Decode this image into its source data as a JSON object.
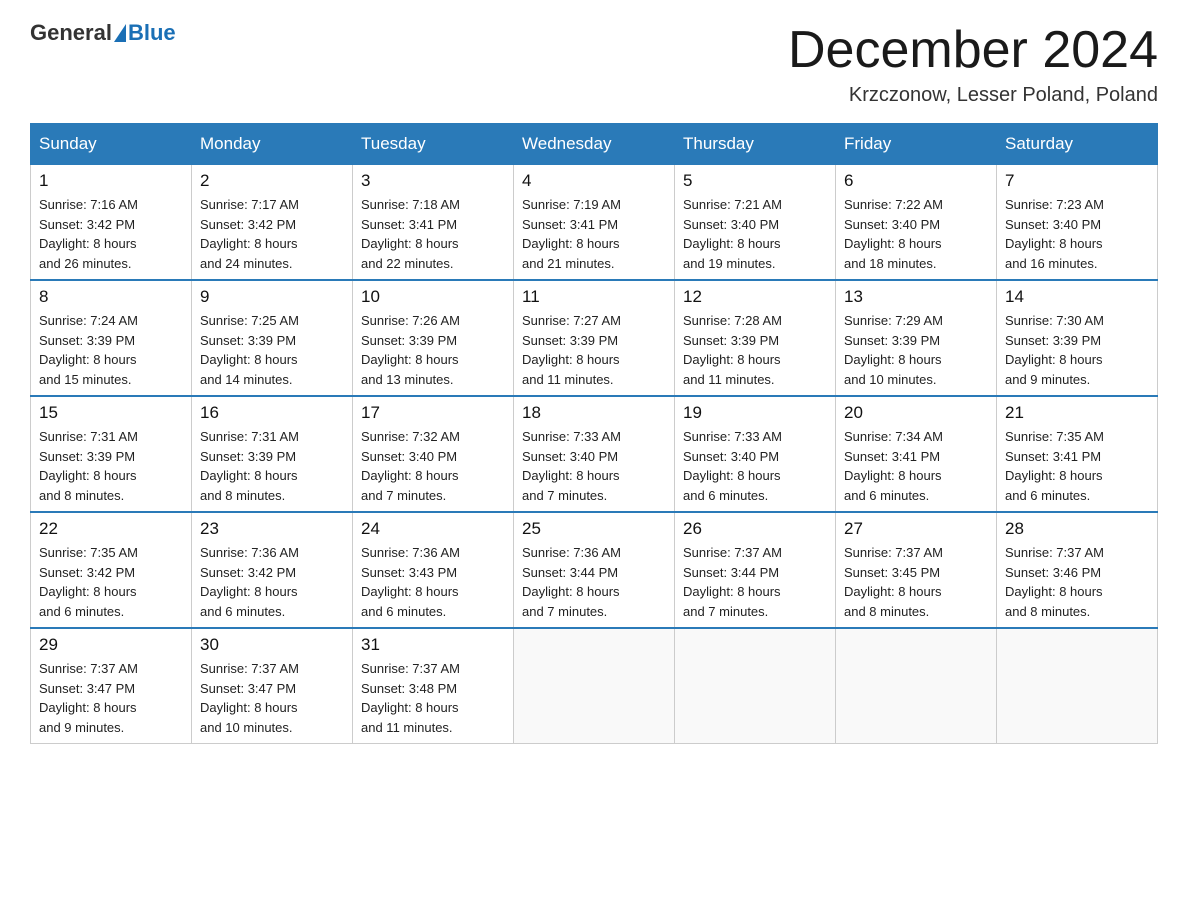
{
  "header": {
    "logo_general": "General",
    "logo_blue": "Blue",
    "month_title": "December 2024",
    "location": "Krzczonow, Lesser Poland, Poland"
  },
  "days_of_week": [
    "Sunday",
    "Monday",
    "Tuesday",
    "Wednesday",
    "Thursday",
    "Friday",
    "Saturday"
  ],
  "weeks": [
    [
      {
        "day": "1",
        "info": "Sunrise: 7:16 AM\nSunset: 3:42 PM\nDaylight: 8 hours\nand 26 minutes."
      },
      {
        "day": "2",
        "info": "Sunrise: 7:17 AM\nSunset: 3:42 PM\nDaylight: 8 hours\nand 24 minutes."
      },
      {
        "day": "3",
        "info": "Sunrise: 7:18 AM\nSunset: 3:41 PM\nDaylight: 8 hours\nand 22 minutes."
      },
      {
        "day": "4",
        "info": "Sunrise: 7:19 AM\nSunset: 3:41 PM\nDaylight: 8 hours\nand 21 minutes."
      },
      {
        "day": "5",
        "info": "Sunrise: 7:21 AM\nSunset: 3:40 PM\nDaylight: 8 hours\nand 19 minutes."
      },
      {
        "day": "6",
        "info": "Sunrise: 7:22 AM\nSunset: 3:40 PM\nDaylight: 8 hours\nand 18 minutes."
      },
      {
        "day": "7",
        "info": "Sunrise: 7:23 AM\nSunset: 3:40 PM\nDaylight: 8 hours\nand 16 minutes."
      }
    ],
    [
      {
        "day": "8",
        "info": "Sunrise: 7:24 AM\nSunset: 3:39 PM\nDaylight: 8 hours\nand 15 minutes."
      },
      {
        "day": "9",
        "info": "Sunrise: 7:25 AM\nSunset: 3:39 PM\nDaylight: 8 hours\nand 14 minutes."
      },
      {
        "day": "10",
        "info": "Sunrise: 7:26 AM\nSunset: 3:39 PM\nDaylight: 8 hours\nand 13 minutes."
      },
      {
        "day": "11",
        "info": "Sunrise: 7:27 AM\nSunset: 3:39 PM\nDaylight: 8 hours\nand 11 minutes."
      },
      {
        "day": "12",
        "info": "Sunrise: 7:28 AM\nSunset: 3:39 PM\nDaylight: 8 hours\nand 11 minutes."
      },
      {
        "day": "13",
        "info": "Sunrise: 7:29 AM\nSunset: 3:39 PM\nDaylight: 8 hours\nand 10 minutes."
      },
      {
        "day": "14",
        "info": "Sunrise: 7:30 AM\nSunset: 3:39 PM\nDaylight: 8 hours\nand 9 minutes."
      }
    ],
    [
      {
        "day": "15",
        "info": "Sunrise: 7:31 AM\nSunset: 3:39 PM\nDaylight: 8 hours\nand 8 minutes."
      },
      {
        "day": "16",
        "info": "Sunrise: 7:31 AM\nSunset: 3:39 PM\nDaylight: 8 hours\nand 8 minutes."
      },
      {
        "day": "17",
        "info": "Sunrise: 7:32 AM\nSunset: 3:40 PM\nDaylight: 8 hours\nand 7 minutes."
      },
      {
        "day": "18",
        "info": "Sunrise: 7:33 AM\nSunset: 3:40 PM\nDaylight: 8 hours\nand 7 minutes."
      },
      {
        "day": "19",
        "info": "Sunrise: 7:33 AM\nSunset: 3:40 PM\nDaylight: 8 hours\nand 6 minutes."
      },
      {
        "day": "20",
        "info": "Sunrise: 7:34 AM\nSunset: 3:41 PM\nDaylight: 8 hours\nand 6 minutes."
      },
      {
        "day": "21",
        "info": "Sunrise: 7:35 AM\nSunset: 3:41 PM\nDaylight: 8 hours\nand 6 minutes."
      }
    ],
    [
      {
        "day": "22",
        "info": "Sunrise: 7:35 AM\nSunset: 3:42 PM\nDaylight: 8 hours\nand 6 minutes."
      },
      {
        "day": "23",
        "info": "Sunrise: 7:36 AM\nSunset: 3:42 PM\nDaylight: 8 hours\nand 6 minutes."
      },
      {
        "day": "24",
        "info": "Sunrise: 7:36 AM\nSunset: 3:43 PM\nDaylight: 8 hours\nand 6 minutes."
      },
      {
        "day": "25",
        "info": "Sunrise: 7:36 AM\nSunset: 3:44 PM\nDaylight: 8 hours\nand 7 minutes."
      },
      {
        "day": "26",
        "info": "Sunrise: 7:37 AM\nSunset: 3:44 PM\nDaylight: 8 hours\nand 7 minutes."
      },
      {
        "day": "27",
        "info": "Sunrise: 7:37 AM\nSunset: 3:45 PM\nDaylight: 8 hours\nand 8 minutes."
      },
      {
        "day": "28",
        "info": "Sunrise: 7:37 AM\nSunset: 3:46 PM\nDaylight: 8 hours\nand 8 minutes."
      }
    ],
    [
      {
        "day": "29",
        "info": "Sunrise: 7:37 AM\nSunset: 3:47 PM\nDaylight: 8 hours\nand 9 minutes."
      },
      {
        "day": "30",
        "info": "Sunrise: 7:37 AM\nSunset: 3:47 PM\nDaylight: 8 hours\nand 10 minutes."
      },
      {
        "day": "31",
        "info": "Sunrise: 7:37 AM\nSunset: 3:48 PM\nDaylight: 8 hours\nand 11 minutes."
      },
      {
        "day": "",
        "info": ""
      },
      {
        "day": "",
        "info": ""
      },
      {
        "day": "",
        "info": ""
      },
      {
        "day": "",
        "info": ""
      }
    ]
  ]
}
